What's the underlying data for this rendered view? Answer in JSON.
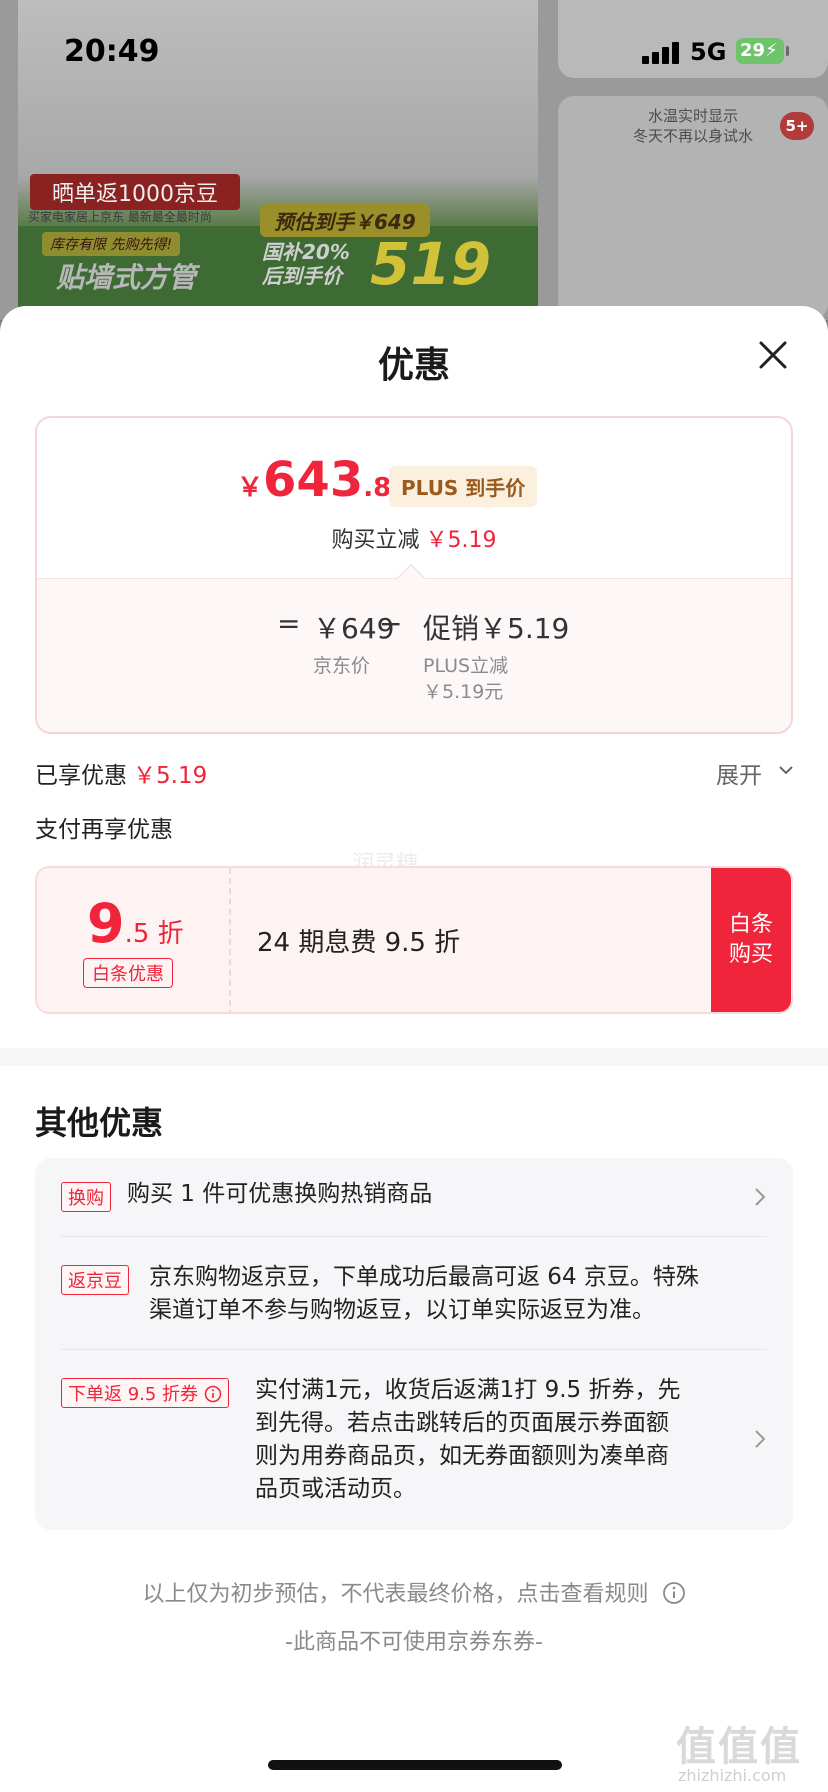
{
  "status_bar": {
    "time": "20:49",
    "network": "5G",
    "battery": "29"
  },
  "background": {
    "banner_red": "晒单返1000京豆",
    "banner_sub": "买家电家居上京东 最新最全最时尚",
    "green_tag": "库存有限 先购先得!",
    "green_big": "贴墙式方管",
    "price_tag": "预估到手￥649",
    "price_sub": "国补20%",
    "price_sub2": "后到手价",
    "price_big": "519",
    "right_text": "水温实时显示",
    "right_text2": "冬天不再以身试水",
    "badge": "5+"
  },
  "sheet": {
    "title": "优惠",
    "close_icon": "close-icon"
  },
  "price_card": {
    "symbol": "￥",
    "price_int": "643",
    "price_dec": ".81",
    "plus_tag": "PLUS 到手价",
    "instant_label": "购买立减",
    "instant_value": "￥5.19",
    "eq": "=",
    "jd_price": "￥649",
    "jd_price_label": "京东价",
    "minus": "−",
    "promo": "促销￥5.19",
    "promo_sub1": "PLUS立减",
    "promo_sub2": "￥5.19元"
  },
  "enjoyed": {
    "label": "已享优惠",
    "value": "￥5.19",
    "expand": "展开"
  },
  "pay_more": {
    "label": "支付再享优惠",
    "watermark": "润灵糖"
  },
  "baitiao": {
    "rate_big": "9",
    "rate_small": ".5 折",
    "tag": "白条优惠",
    "desc": "24 期息费 9.5 折",
    "button_line1": "白条",
    "button_line2": "购买"
  },
  "other": {
    "title": "其他优惠",
    "items": [
      {
        "tag": "换购",
        "text": "购买 1 件可优惠换购热销商品"
      },
      {
        "tag": "返京豆",
        "line1": "京东购物返京豆，下单成功后最高可返 64 京豆。特殊",
        "line2": "渠道订单不参与购物返豆，以订单实际返豆为准。"
      },
      {
        "tag": "下单返 9.5 折券",
        "line1": "实付满1元，收货后返满1打 9.5 折券，先",
        "line2": "到先得。若点击跳转后的页面展示券面额",
        "line3": "则为用券商品页，如无券面额则为凑单商",
        "line4": "品页或活动页。"
      }
    ]
  },
  "footer": {
    "note": "以上仅为初步预估，不代表最终价格，点击查看规则",
    "note2": "-此商品不可使用京券东券-",
    "site_mark": "值值值",
    "site_url": "zhizhizhi.com"
  }
}
